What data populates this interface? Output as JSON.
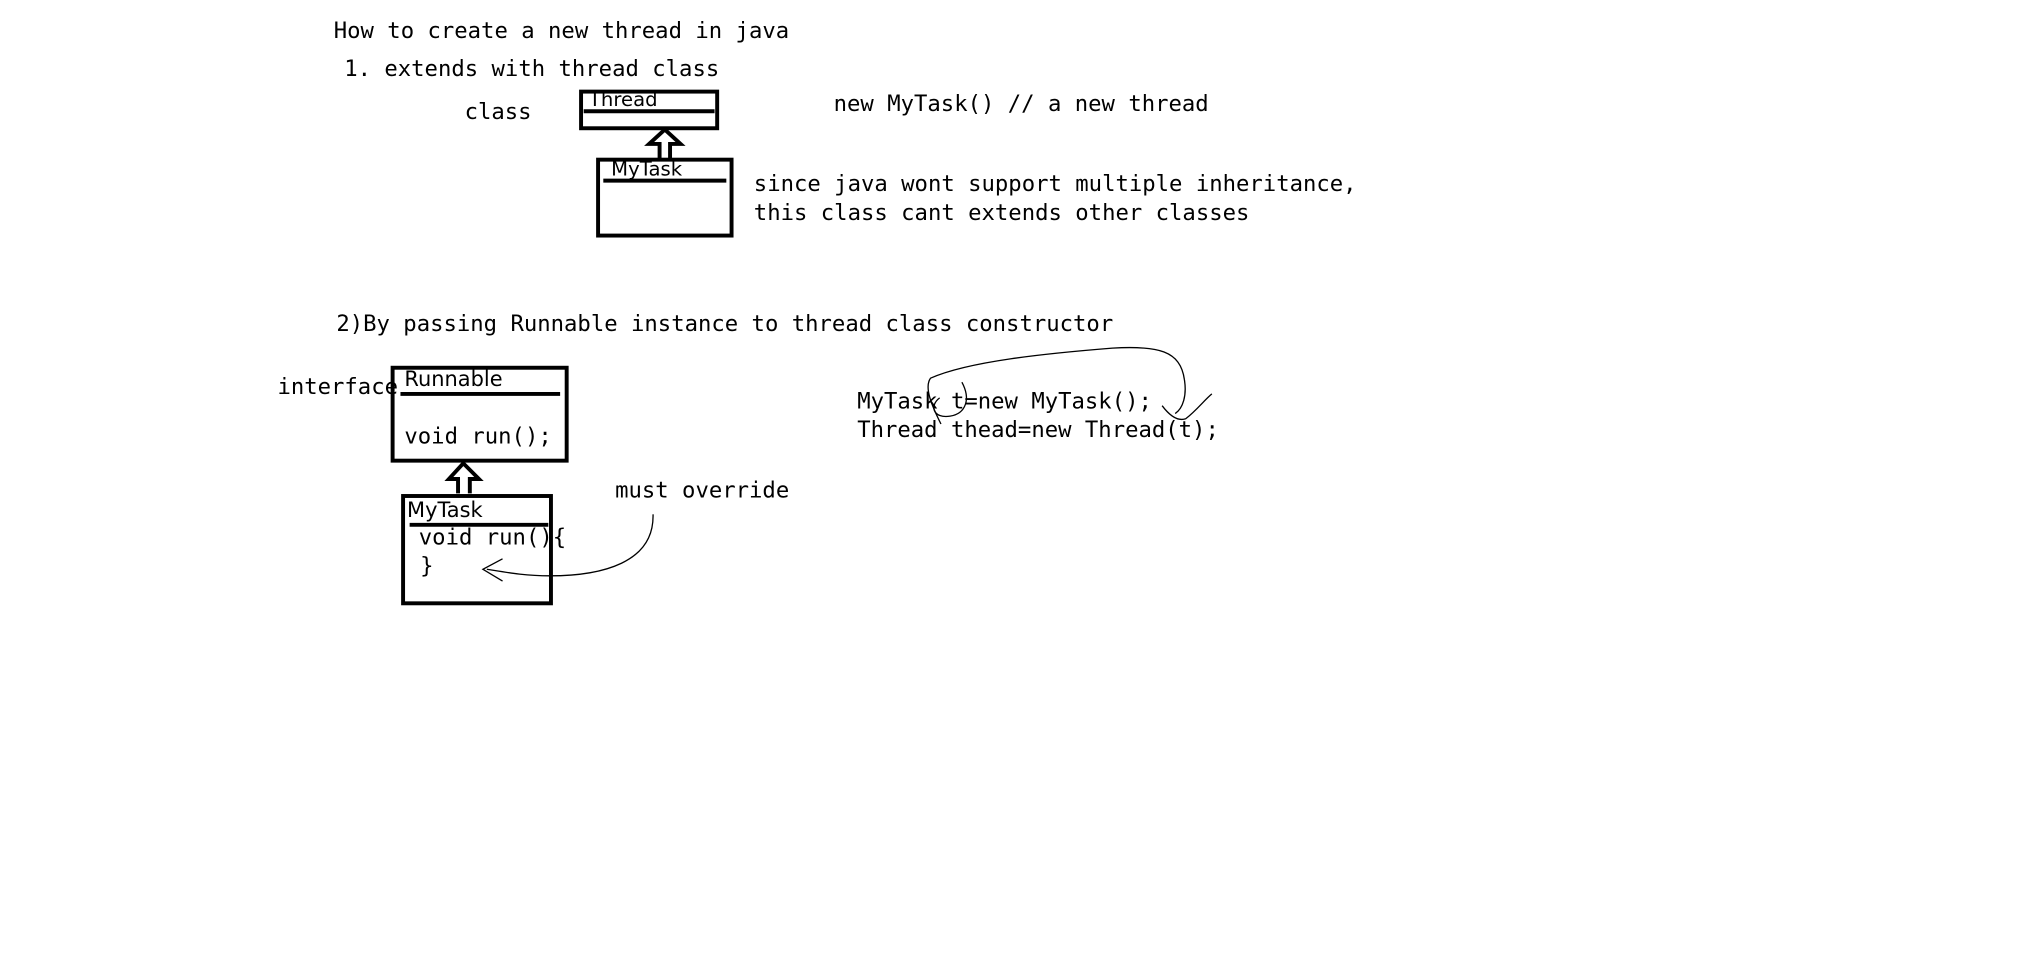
{
  "title": "How to create a new thread in java",
  "section1": {
    "heading": "1. extends with thread class",
    "class_keyword": "class",
    "parent_box_label": "Thread",
    "child_box_label": "MyTask",
    "code_note": "new MyTask() // a new thread",
    "note_line1": "since java wont support multiple inheritance,",
    "note_line2": "this class cant extends other classes"
  },
  "section2": {
    "heading": "2)By passing Runnable instance to thread class constructor",
    "interface_keyword": "interface",
    "interface_box_label": "Runnable",
    "interface_method": "void run();",
    "impl_box_label": "MyTask",
    "impl_method_line1": "void run(){",
    "impl_method_line2": "}",
    "annotation": "must override",
    "code_line1": "MyTask t=new MyTask();",
    "code_line2": "Thread thead=new Thread(t);"
  }
}
